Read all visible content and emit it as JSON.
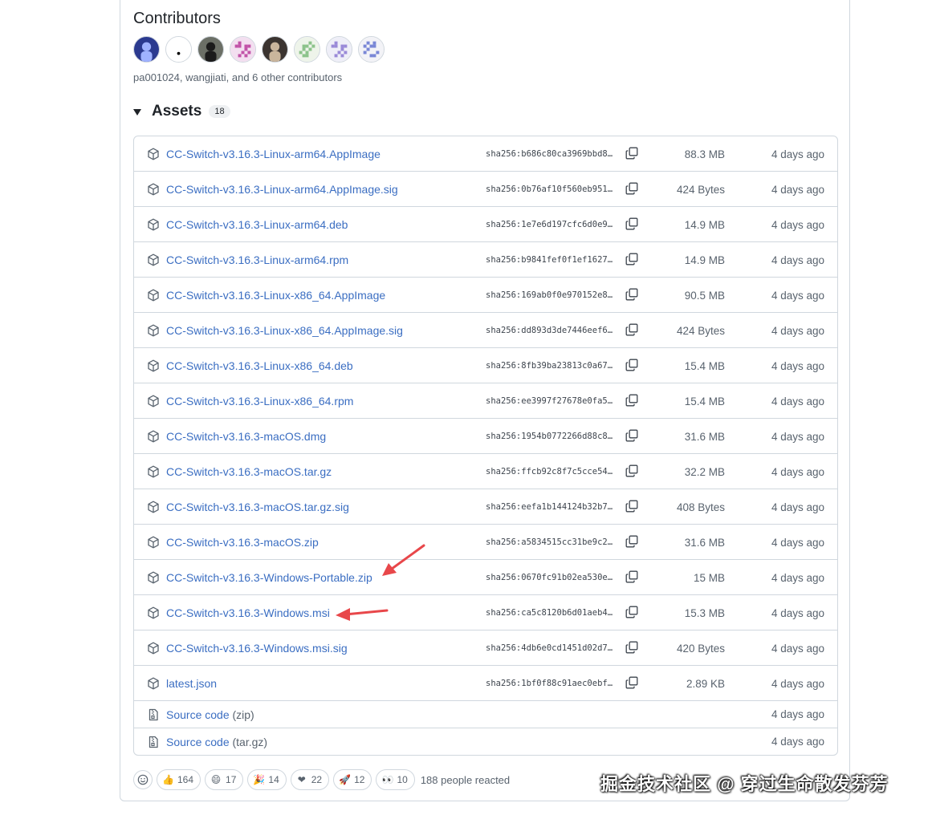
{
  "contributors": {
    "title": "Contributors",
    "avatars": [
      {
        "name": "avatar-1",
        "bg": "#2b3a8f",
        "fg": "#9fb2ff"
      },
      {
        "name": "avatar-2",
        "bg": "#ffffff",
        "fg": "#000000"
      },
      {
        "name": "avatar-3",
        "bg": "#6b6f66",
        "fg": "#1b1b1b"
      },
      {
        "name": "avatar-4",
        "bg": "#f3dff0",
        "fg": "#c253a8"
      },
      {
        "name": "avatar-5",
        "bg": "#3b3430",
        "fg": "#c9b59c"
      },
      {
        "name": "avatar-6",
        "bg": "#eef4ea",
        "fg": "#8cc38b"
      },
      {
        "name": "avatar-7",
        "bg": "#efeff8",
        "fg": "#9a8ad8"
      },
      {
        "name": "avatar-8",
        "bg": "#f3f3f7",
        "fg": "#7a87d6"
      }
    ],
    "summary": "pa001024, wangjiati, and 6 other contributors"
  },
  "assets": {
    "title": "Assets",
    "count": "18",
    "files": [
      {
        "name": "CC-Switch-v3.16.3-Linux-arm64.AppImage",
        "sha": "sha256:b686c80ca3969bbd8…",
        "size": "88.3 MB",
        "date": "4 days ago"
      },
      {
        "name": "CC-Switch-v3.16.3-Linux-arm64.AppImage.sig",
        "sha": "sha256:0b76af10f560eb951…",
        "size": "424 Bytes",
        "date": "4 days ago"
      },
      {
        "name": "CC-Switch-v3.16.3-Linux-arm64.deb",
        "sha": "sha256:1e7e6d197cfc6d0e9…",
        "size": "14.9 MB",
        "date": "4 days ago"
      },
      {
        "name": "CC-Switch-v3.16.3-Linux-arm64.rpm",
        "sha": "sha256:b9841fef0f1ef1627…",
        "size": "14.9 MB",
        "date": "4 days ago"
      },
      {
        "name": "CC-Switch-v3.16.3-Linux-x86_64.AppImage",
        "sha": "sha256:169ab0f0e970152e8…",
        "size": "90.5 MB",
        "date": "4 days ago"
      },
      {
        "name": "CC-Switch-v3.16.3-Linux-x86_64.AppImage.sig",
        "sha": "sha256:dd893d3de7446eef6…",
        "size": "424 Bytes",
        "date": "4 days ago"
      },
      {
        "name": "CC-Switch-v3.16.3-Linux-x86_64.deb",
        "sha": "sha256:8fb39ba23813c0a67…",
        "size": "15.4 MB",
        "date": "4 days ago"
      },
      {
        "name": "CC-Switch-v3.16.3-Linux-x86_64.rpm",
        "sha": "sha256:ee3997f27678e0fa5…",
        "size": "15.4 MB",
        "date": "4 days ago"
      },
      {
        "name": "CC-Switch-v3.16.3-macOS.dmg",
        "sha": "sha256:1954b0772266d88c8…",
        "size": "31.6 MB",
        "date": "4 days ago"
      },
      {
        "name": "CC-Switch-v3.16.3-macOS.tar.gz",
        "sha": "sha256:ffcb92c8f7c5cce54…",
        "size": "32.2 MB",
        "date": "4 days ago"
      },
      {
        "name": "CC-Switch-v3.16.3-macOS.tar.gz.sig",
        "sha": "sha256:eefa1b144124b32b7…",
        "size": "408 Bytes",
        "date": "4 days ago"
      },
      {
        "name": "CC-Switch-v3.16.3-macOS.zip",
        "sha": "sha256:a5834515cc31be9c2…",
        "size": "31.6 MB",
        "date": "4 days ago"
      },
      {
        "name": "CC-Switch-v3.16.3-Windows-Portable.zip",
        "sha": "sha256:0670fc91b02ea530e…",
        "size": "15 MB",
        "date": "4 days ago"
      },
      {
        "name": "CC-Switch-v3.16.3-Windows.msi",
        "sha": "sha256:ca5c8120b6d01aeb4…",
        "size": "15.3 MB",
        "date": "4 days ago"
      },
      {
        "name": "CC-Switch-v3.16.3-Windows.msi.sig",
        "sha": "sha256:4db6e0cd1451d02d7…",
        "size": "420 Bytes",
        "date": "4 days ago"
      },
      {
        "name": "latest.json",
        "sha": "sha256:1bf0f88c91aec0ebf…",
        "size": "2.89 KB",
        "date": "4 days ago"
      }
    ],
    "source": [
      {
        "label": "Source code",
        "kind": "(zip)",
        "date": "4 days ago"
      },
      {
        "label": "Source code",
        "kind": "(tar.gz)",
        "date": "4 days ago"
      }
    ]
  },
  "reactions": {
    "items": [
      {
        "icon": "thumbs-up-icon",
        "emoji": "👍",
        "count": "164"
      },
      {
        "icon": "laugh-icon",
        "emoji": "😄",
        "count": "17"
      },
      {
        "icon": "hooray-icon",
        "emoji": "🎉",
        "count": "14"
      },
      {
        "icon": "heart-icon",
        "emoji": "❤",
        "count": "22"
      },
      {
        "icon": "rocket-icon",
        "emoji": "🚀",
        "count": "12"
      },
      {
        "icon": "eyes-icon",
        "emoji": "👀",
        "count": "10"
      }
    ],
    "summary": "188 people reacted"
  },
  "watermark": "掘金技术社区 @ 穿过生命散发芬芳",
  "colors": {
    "link": "#3b6ec2",
    "annotation_arrow": "#e8474a"
  }
}
